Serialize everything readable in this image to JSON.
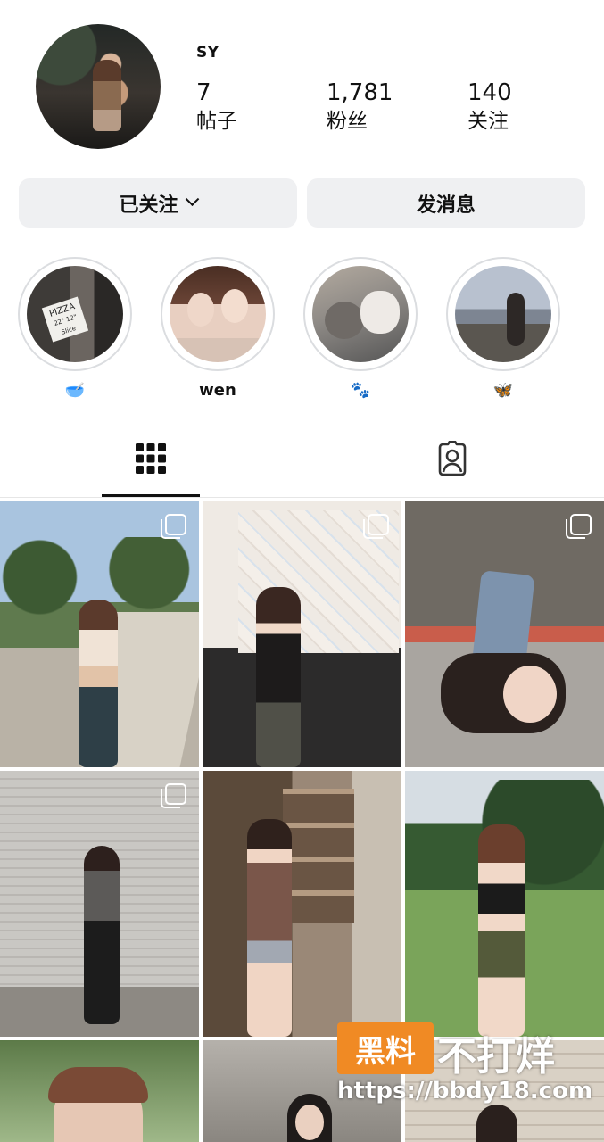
{
  "profile": {
    "username": "SY",
    "stats": [
      {
        "value": "7",
        "label": "帖子"
      },
      {
        "value": "1,781",
        "label": "粉丝"
      },
      {
        "value": "140",
        "label": "关注"
      }
    ]
  },
  "actions": {
    "following_label": "已关注",
    "message_label": "发消息"
  },
  "highlights": [
    {
      "caption": "🥣",
      "icon": "bowl-emoji"
    },
    {
      "caption": "wen",
      "icon": ""
    },
    {
      "caption": "🐾",
      "icon": "paw-emoji"
    },
    {
      "caption": "🦋",
      "icon": "butterfly-emoji"
    }
  ],
  "highlight_texts": {
    "pizza_sign": "PIZZA",
    "sign_small": "22\" 12\" Slice"
  },
  "tabs": [
    {
      "name": "posts-grid-tab",
      "icon": "grid-icon",
      "active": true
    },
    {
      "name": "tagged-tab",
      "icon": "tagged-person-icon",
      "active": false
    }
  ],
  "posts": [
    {
      "multi": true
    },
    {
      "multi": true
    },
    {
      "multi": true
    },
    {
      "multi": true
    },
    {
      "multi": false
    },
    {
      "multi": false
    },
    {
      "multi": false
    },
    {
      "multi": false
    },
    {
      "multi": false
    }
  ],
  "watermark": {
    "logo_text": "黑料",
    "brand_text": "不打烊",
    "url": "https://bbdy18.com"
  },
  "colors": {
    "button_bg": "#eff0f2",
    "accent_orange": "#f08a24"
  }
}
